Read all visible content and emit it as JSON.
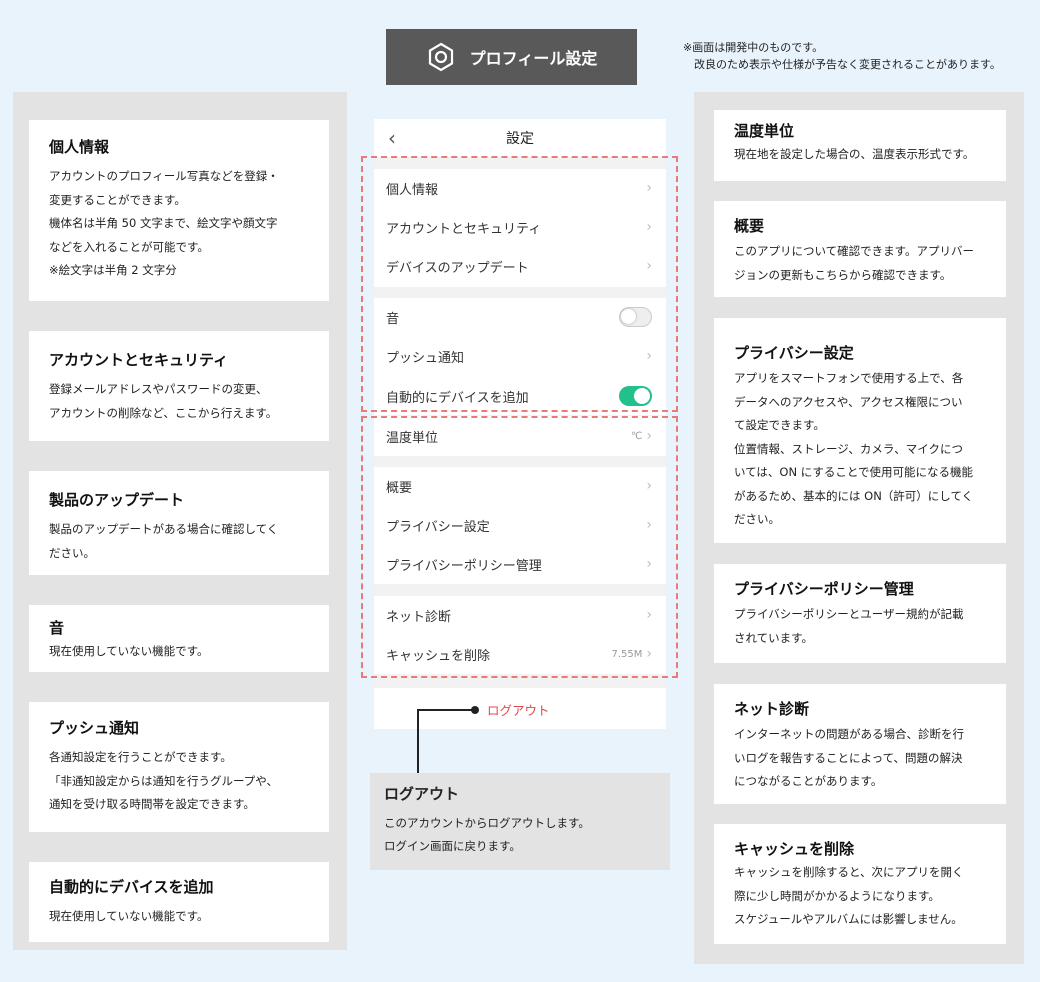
{
  "header": {
    "title": "プロフィール設定",
    "icon": "hexagon-gear-icon"
  },
  "notice": {
    "line1": "※画面は開発中のものです。",
    "line2": "改良のため表示や仕様が予告なく変更されることがあります。"
  },
  "colors": {
    "accent": "#22c08a",
    "dash": "#e87a7a",
    "logout": "#e04848",
    "header_bg": "#595959"
  },
  "left_cards": [
    {
      "title": "個人情報",
      "lines": [
        "アカウントのプロフィール写真などを登録・",
        "変更することができます。",
        "機体名は半角 50 文字まで、絵文字や顔文字",
        "などを入れることが可能です。",
        "※絵文字は半角 2 文字分"
      ]
    },
    {
      "title": "アカウントとセキュリティ",
      "lines": [
        "登録メールアドレスやパスワードの変更、",
        "アカウントの削除など、ここから行えます。"
      ]
    },
    {
      "title": "製品のアップデート",
      "lines": [
        "製品のアップデートがある場合に確認してく",
        "ださい。"
      ]
    },
    {
      "title": "音",
      "lines": [
        "現在使用していない機能です。"
      ]
    },
    {
      "title": "プッシュ通知",
      "lines": [
        "各通知設定を行うことができます。",
        "「非通知設定からは通知を行うグループや、",
        "通知を受け取る時間帯を設定できます。"
      ]
    },
    {
      "title": "自動的にデバイスを追加",
      "lines": [
        "現在使用していない機能です。"
      ]
    }
  ],
  "right_cards": [
    {
      "title": "温度単位",
      "lines": [
        "現在地を設定した場合の、温度表示形式です。"
      ]
    },
    {
      "title": "概要",
      "lines": [
        "このアプリについて確認できます。アプリバー",
        "ジョンの更新もこちらから確認できます。"
      ]
    },
    {
      "title": "プライバシー設定",
      "lines": [
        "アプリをスマートフォンで使用する上で、各",
        "データへのアクセスや、アクセス権限につい",
        "て設定できます。",
        "位置情報、ストレージ、カメラ、マイクにつ",
        "いては、ON にすることで使用可能になる機能",
        "があるため、基本的には ON（許可）にしてく",
        "ださい。"
      ]
    },
    {
      "title": "プライバシーポリシー管理",
      "lines": [
        "プライバシーポリシーとユーザー規約が記載",
        "されています。"
      ]
    },
    {
      "title": "ネット診断",
      "lines": [
        "インターネットの問題がある場合、診断を行",
        "いログを報告することによって、問題の解決",
        "につながることがあります。"
      ]
    },
    {
      "title": "キャッシュを削除",
      "lines": [
        "キャッシュを削除すると、次にアプリを開く",
        "際に少し時間がかかるようになります。",
        "スケジュールやアルバムには影響しません。"
      ]
    }
  ],
  "phone": {
    "title": "設定",
    "back_icon": "back-chevron-icon",
    "rows": [
      {
        "label": "個人情報",
        "type": "link"
      },
      {
        "label": "アカウントとセキュリティ",
        "type": "link"
      },
      {
        "label": "デバイスのアップデート",
        "type": "link"
      },
      {
        "label": "音",
        "type": "toggle",
        "on": false
      },
      {
        "label": "プッシュ通知",
        "type": "link"
      },
      {
        "label": "自動的にデバイスを追加",
        "type": "toggle",
        "on": true
      },
      {
        "label": "温度単位",
        "type": "link",
        "value": "℃"
      },
      {
        "label": "概要",
        "type": "link"
      },
      {
        "label": "プライバシー設定",
        "type": "link"
      },
      {
        "label": "プライバシーポリシー管理",
        "type": "link"
      },
      {
        "label": "ネット診断",
        "type": "link"
      },
      {
        "label": "キャッシュを削除",
        "type": "link",
        "value": "7.55M"
      }
    ],
    "logout": "ログアウト"
  },
  "logout_card": {
    "title": "ログアウト",
    "lines": [
      "このアカウントからログアウトします。",
      "ログイン画面に戻ります。"
    ]
  }
}
